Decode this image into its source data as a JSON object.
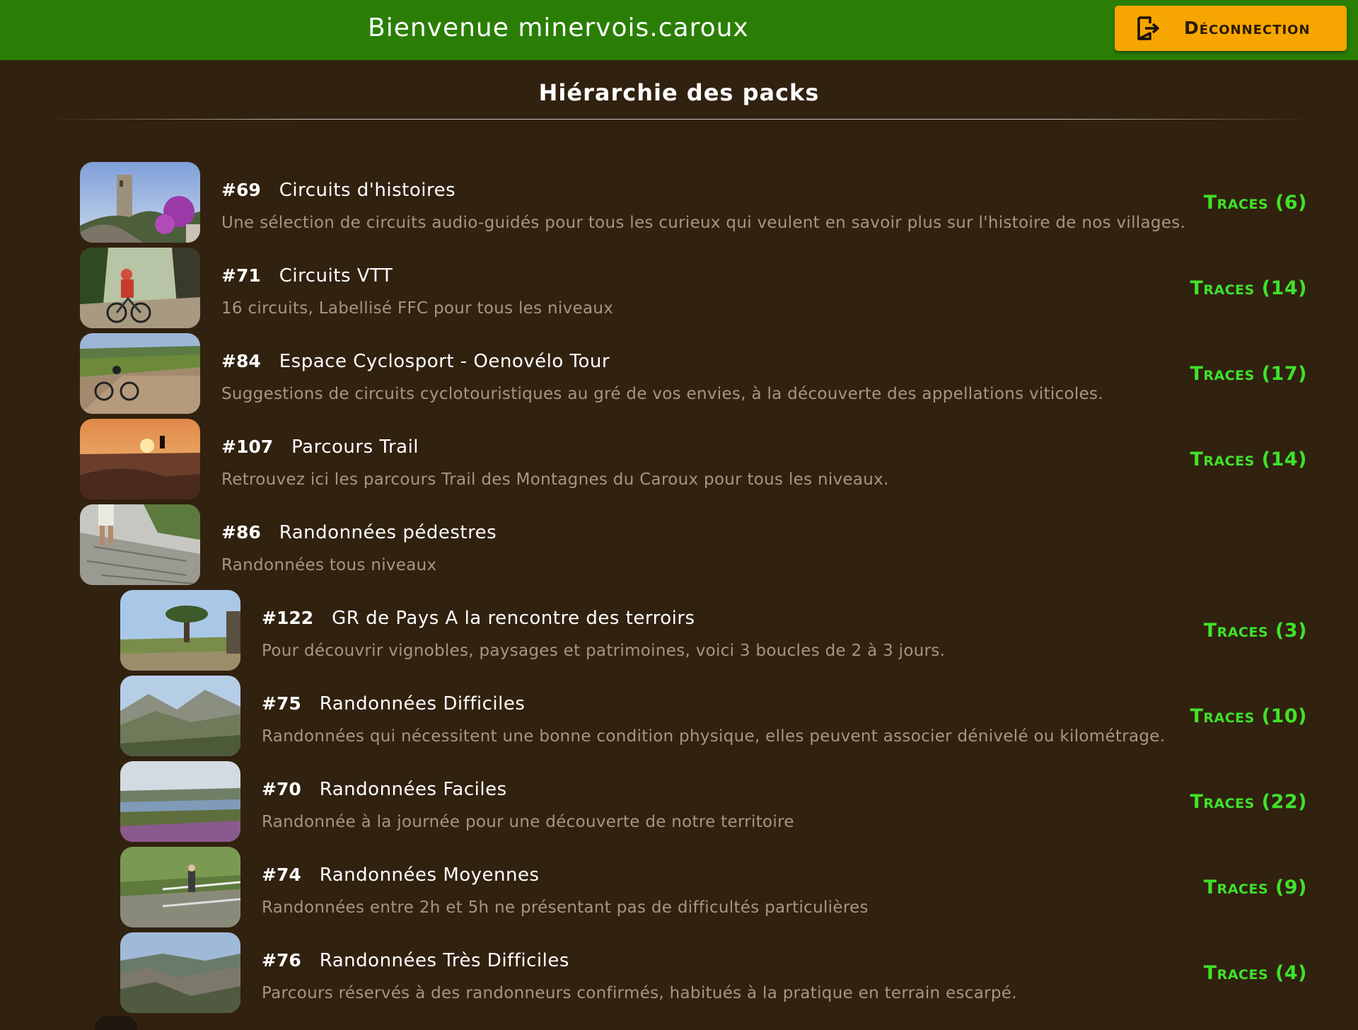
{
  "header": {
    "welcome": "Bienvenue minervois.caroux",
    "logout_label": "Déconnection"
  },
  "section_title": "Hiérarchie des packs",
  "colors": {
    "header_bg": "#2a7e05",
    "page_bg": "#31210f",
    "logout_bg": "#f7a500",
    "traces": "#3fe22a"
  },
  "packs": [
    {
      "id": "#69",
      "title": "Circuits d'histoires",
      "desc": "Une sélection de circuits audio-guidés pour tous les curieux qui veulent en savoir plus sur l'histoire de nos villages.",
      "traces": "Traces (6)",
      "thumb": "tower-village-photo"
    },
    {
      "id": "#71",
      "title": "Circuits VTT",
      "desc": "16 circuits, Labellisé FFC pour tous les niveaux",
      "traces": "Traces (14)",
      "thumb": "mountain-biker-photo"
    },
    {
      "id": "#84",
      "title": "Espace Cyclosport - Oenovélo Tour",
      "desc": "Suggestions de circuits cyclotouristiques au gré de vos envies, à la découverte des appellations viticoles.",
      "traces": "Traces (17)",
      "thumb": "cyclist-vineyard-photo"
    },
    {
      "id": "#107",
      "title": "Parcours Trail",
      "desc": "Retrouvez ici les parcours Trail des Montagnes du Caroux pour tous les niveaux.",
      "traces": "Traces (14)",
      "thumb": "trail-runner-sunset-photo"
    },
    {
      "id": "#86",
      "title": "Randonnées pédestres",
      "desc": "Randonnées tous niveaux",
      "traces": "",
      "thumb": "hiker-rock-path-photo"
    },
    {
      "id": "#122",
      "title": "GR de Pays A la rencontre des terroirs",
      "desc": "Pour découvrir vignobles, paysages et patrimoines, voici 3 boucles de 2 à 3 jours.",
      "traces": "Traces (3)",
      "thumb": "tree-landscape-photo"
    },
    {
      "id": "#75",
      "title": "Randonnées Difficiles",
      "desc": "Randonnées qui nécessitent une bonne condition physique, elles peuvent associer dénivelé ou kilométrage.",
      "traces": "Traces (10)",
      "thumb": "rocky-mountains-photo"
    },
    {
      "id": "#70",
      "title": "Randonnées Faciles",
      "desc": "Randonnée à la journée pour une découverte de notre territoire",
      "traces": "Traces (22)",
      "thumb": "lake-heather-photo"
    },
    {
      "id": "#74",
      "title": "Randonnées Moyennes",
      "desc": "Randonnées entre 2h et 5h ne présentant pas de difficultés particulières",
      "traces": "Traces (9)",
      "thumb": "footbridge-hikers-photo"
    },
    {
      "id": "#76",
      "title": "Randonnées Très Difficiles",
      "desc": "Parcours réservés à des randonneurs confirmés, habitués à la pratique en terrain escarpé.",
      "traces": "Traces (4)",
      "thumb": "steep-terrain-photo"
    }
  ]
}
